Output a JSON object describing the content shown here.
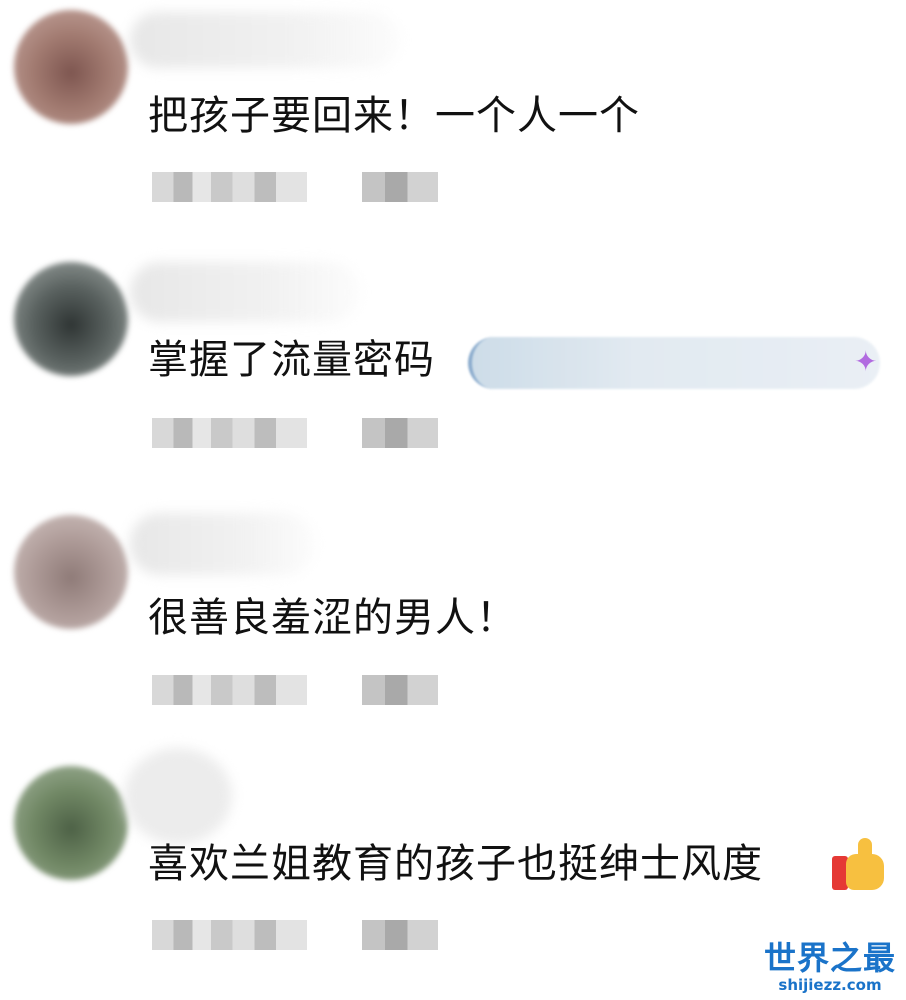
{
  "comments": [
    {
      "text": "把孩子要回来！一个人一个"
    },
    {
      "text": "掌握了流量密码"
    },
    {
      "text": "很善良羞涩的男人！"
    },
    {
      "text": "喜欢兰姐教育的孩子也挺绅士风度"
    }
  ],
  "icons": {
    "thumbs_up": "thumbs-up-icon",
    "sparkle": "sparkle-icon"
  },
  "watermark": {
    "title": "世界之最",
    "url": "shijiezz.com"
  }
}
